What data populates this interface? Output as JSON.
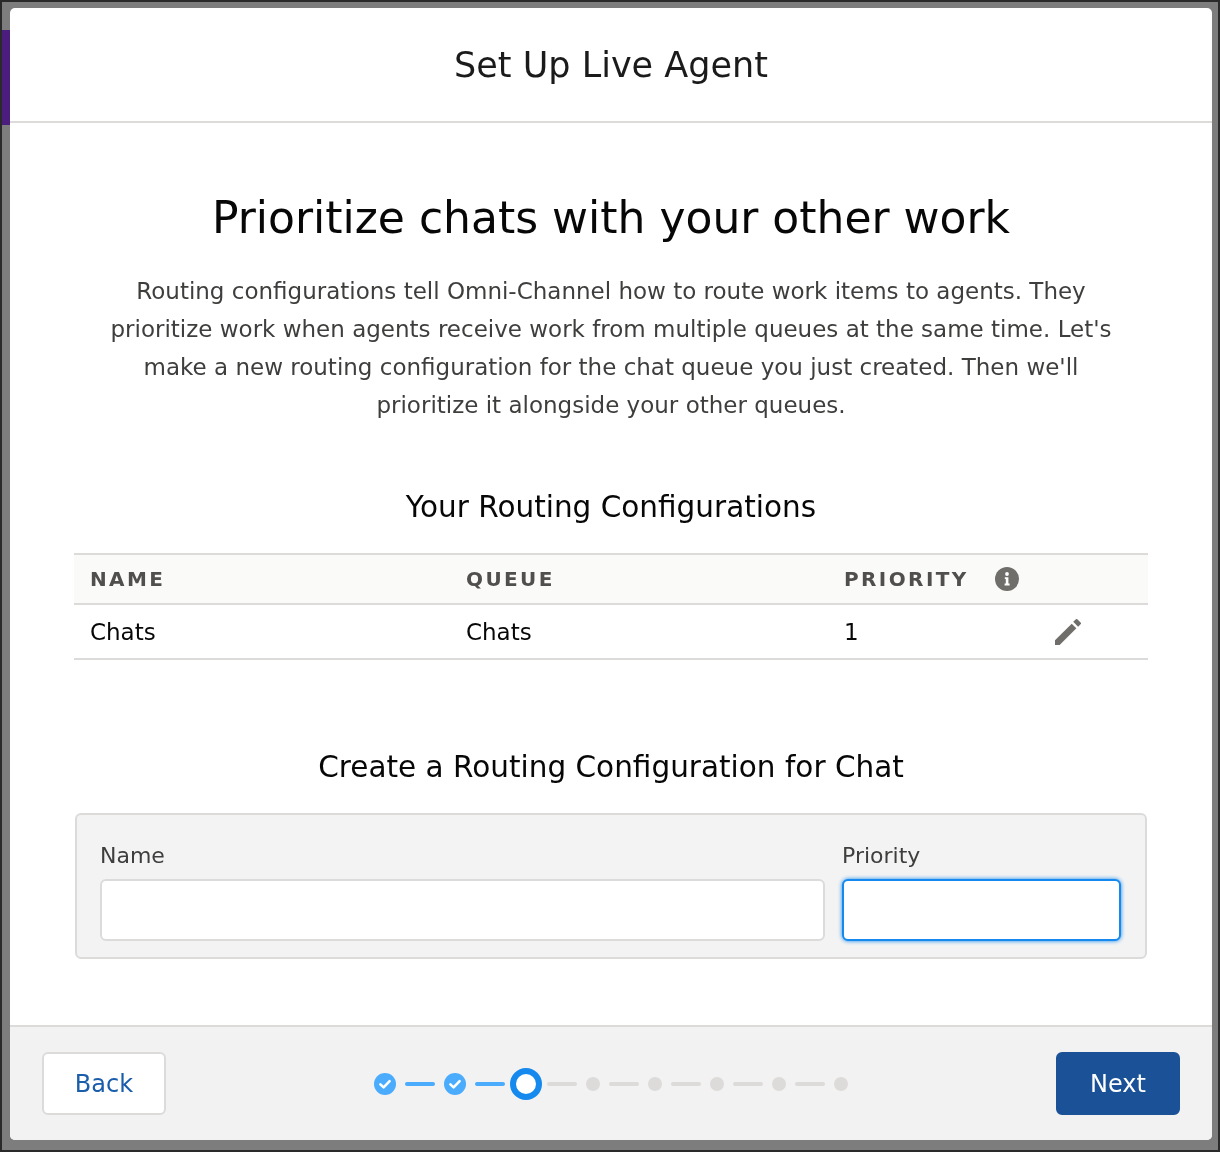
{
  "window": {
    "title": "Set Up Live Agent"
  },
  "intro": {
    "heading": "Prioritize chats with your other work",
    "description": "Routing configurations tell Omni-Channel how to route work items to agents. They prioritize work when agents receive work from multiple queues at the same time. Let's make a new routing configuration for the chat queue you just created. Then we'll prioritize it alongside your other queues."
  },
  "configurations_table": {
    "title": "Your Routing Configurations",
    "columns": [
      {
        "label": "NAME",
        "info": false
      },
      {
        "label": "QUEUE",
        "info": false
      },
      {
        "label": "PRIORITY",
        "info": true
      }
    ],
    "rows": [
      {
        "name": "Chats",
        "queue": "Chats",
        "priority": "1",
        "editable": true
      }
    ]
  },
  "create_form": {
    "title": "Create a Routing Configuration for Chat",
    "fields": [
      {
        "label": "Name",
        "focused": false
      },
      {
        "label": "Priority",
        "focused": true
      }
    ]
  },
  "footer": {
    "back_button": "Back",
    "next_button": "Next",
    "progress_steps": [
      {
        "kind": "complete"
      },
      {
        "kind": "complete"
      },
      {
        "kind": "current"
      },
      {
        "kind": "upcoming"
      },
      {
        "kind": "upcoming"
      },
      {
        "kind": "upcoming"
      },
      {
        "kind": "upcoming"
      },
      {
        "kind": "upcoming"
      }
    ]
  }
}
